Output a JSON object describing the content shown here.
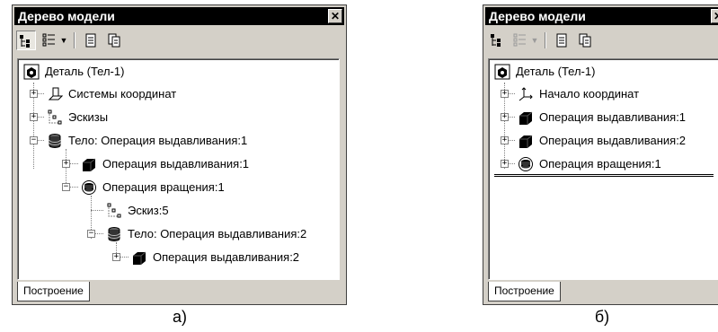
{
  "panel_a": {
    "title": "Дерево модели",
    "close_glyph": "✕",
    "toolbar": [
      "tree-structure-icon",
      "tree-list-icon",
      "dropdown-arrow-icon",
      "page-icon",
      "copy-icon"
    ],
    "tree": [
      {
        "label": "Деталь (Тел-1)",
        "icon": "part-icon"
      },
      {
        "label": "Системы координат",
        "icon": "coordinate-plane-icon"
      },
      {
        "label": "Эскизы",
        "icon": "sketch-icon"
      },
      {
        "label": "Тело:  Операция выдавливания:1",
        "icon": "body-cylinder-icon"
      },
      {
        "label": "Операция выдавливания:1",
        "icon": "extrusion-icon"
      },
      {
        "label": "Операция вращения:1",
        "icon": "rotation-icon"
      },
      {
        "label": "Эскиз:5",
        "icon": "sketch-icon"
      },
      {
        "label": "Тело:  Операция выдавливания:2",
        "icon": "body-cylinder-icon"
      },
      {
        "label": "Операция выдавливания:2",
        "icon": "extrusion-icon"
      }
    ],
    "tab_label": "Построение",
    "caption": "а)"
  },
  "panel_b": {
    "title": "Дерево модели",
    "close_glyph": "✕",
    "toolbar": [
      "tree-structure-icon",
      "tree-list-icon",
      "dropdown-arrow-icon",
      "page-icon",
      "copy-icon"
    ],
    "tree": [
      {
        "label": "Деталь (Тел-1)",
        "icon": "part-icon"
      },
      {
        "label": "Начало координат",
        "icon": "origin-axes-icon"
      },
      {
        "label": "Операция выдавливания:1",
        "icon": "extrusion-icon"
      },
      {
        "label": "Операция выдавливания:2",
        "icon": "extrusion-icon"
      },
      {
        "label": "Операция вращения:1",
        "icon": "rotation-icon"
      }
    ],
    "tab_label": "Построение",
    "caption": "б)"
  },
  "colors": {
    "panel_bg": "#d4d0c8",
    "titlebar_bg": "#000000",
    "titlebar_text": "#ffffff",
    "tree_bg": "#ffffff"
  }
}
